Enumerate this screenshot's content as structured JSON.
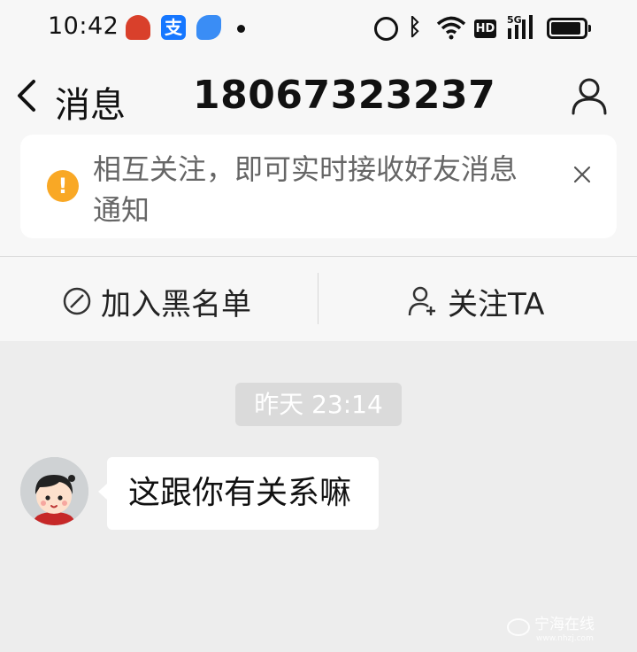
{
  "status_bar": {
    "time": "10:42",
    "hd": "HD",
    "network": "5G",
    "app_icons": [
      "taobao-app-icon",
      "alipay-app-icon",
      "feather-app-icon"
    ]
  },
  "nav": {
    "back_label": "消息",
    "title": "18067323237"
  },
  "notice": {
    "text": "相互关注，即可实时接收好友消息通知"
  },
  "actions": {
    "block_label": "加入黑名单",
    "follow_label": "关注TA"
  },
  "chat": {
    "timestamp": "昨天 23:14",
    "messages": [
      {
        "text": "这跟你有关系嘛"
      }
    ]
  },
  "watermark": {
    "text": "宁海在线",
    "url": "www.nhzj.com"
  },
  "colors": {
    "background": "#ededed",
    "header_bg": "#f7f7f7",
    "notice_warning": "#f9a825",
    "timestamp_bg": "#dadada"
  }
}
